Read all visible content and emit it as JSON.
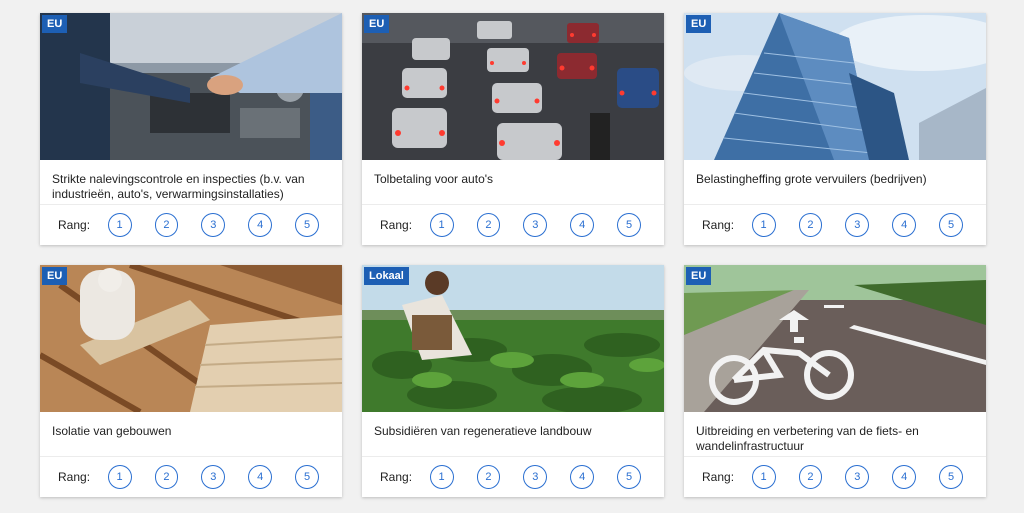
{
  "rank_label": "Rang:",
  "rank_options": [
    "1",
    "2",
    "3",
    "4",
    "5"
  ],
  "cards": [
    {
      "badge": "EU",
      "title": "Strikte nalevingscontrole en inspecties (b.v. van industrieën, auto's, verwarmingsinstallaties)"
    },
    {
      "badge": "EU",
      "title": "Tolbetaling voor auto's"
    },
    {
      "badge": "EU",
      "title": "Belastingheffing grote vervuilers (bedrijven)"
    },
    {
      "badge": "EU",
      "title": "Isolatie van gebouwen"
    },
    {
      "badge": "Lokaal",
      "title": "Subsidiëren van regeneratieve landbouw"
    },
    {
      "badge": "EU",
      "title": "Uitbreiding en verbetering van de fiets- en wandelinfrastructuur"
    }
  ],
  "colors": {
    "accent": "#2a6fd1",
    "badge": "#1d5fb4"
  }
}
